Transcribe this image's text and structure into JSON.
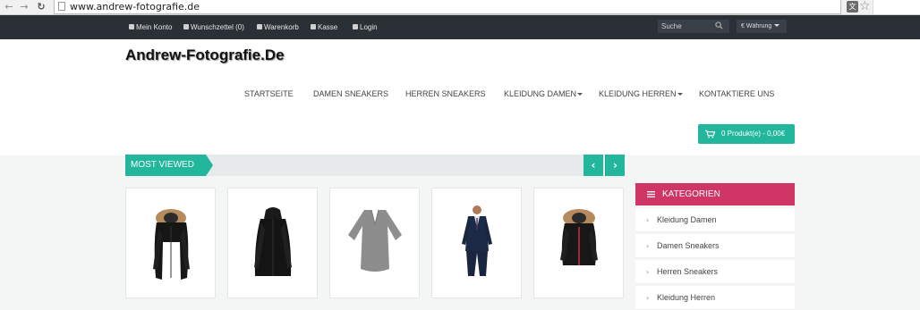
{
  "browser": {
    "url": "www.andrew-fotografie.de",
    "back_icon": "back-arrow-icon",
    "forward_icon": "forward-arrow-icon",
    "reload_icon": "reload-icon"
  },
  "topbar": {
    "links": [
      {
        "label": "Mein Konto",
        "icon": "user-icon"
      },
      {
        "label": "Wunschzettel (0)",
        "icon": "heart-icon"
      },
      {
        "label": "Warenkorb",
        "icon": "dollar-icon"
      },
      {
        "label": "Kasse",
        "icon": "list-icon"
      },
      {
        "label": "Login",
        "icon": "key-icon"
      }
    ],
    "search_placeholder": "Suche",
    "currency_label": "€ Währung"
  },
  "header": {
    "logo": "Andrew-Fotografie.De",
    "nav": [
      {
        "label": "STARTSEITE",
        "dropdown": false
      },
      {
        "label": "DAMEN SNEAKERS",
        "dropdown": false
      },
      {
        "label": "HERREN SNEAKERS",
        "dropdown": false
      },
      {
        "label": "KLEIDUNG DAMEN",
        "dropdown": true
      },
      {
        "label": "KLEIDUNG HERREN",
        "dropdown": true
      },
      {
        "label": "KONTAKTIERE UNS",
        "dropdown": false
      }
    ],
    "cart_label": "0 Produkt(e) - 0,00€"
  },
  "most_viewed": {
    "title": "MOST VIEWED",
    "prev_label": "‹",
    "next_label": "›"
  },
  "products": [
    {
      "image": "black-parka-fur-hood"
    },
    {
      "image": "black-hooded-coat"
    },
    {
      "image": "grey-blouse"
    },
    {
      "image": "navy-suit"
    },
    {
      "image": "black-jacket-fur-hood"
    }
  ],
  "categories": {
    "title": "KATEGORIEN",
    "items": [
      "Kleidung Damen",
      "Damen Sneakers",
      "Herren Sneakers",
      "Kleidung Herren"
    ]
  },
  "colors": {
    "accent": "#22b79c",
    "category": "#cf3565",
    "topbar": "#2b3036"
  }
}
